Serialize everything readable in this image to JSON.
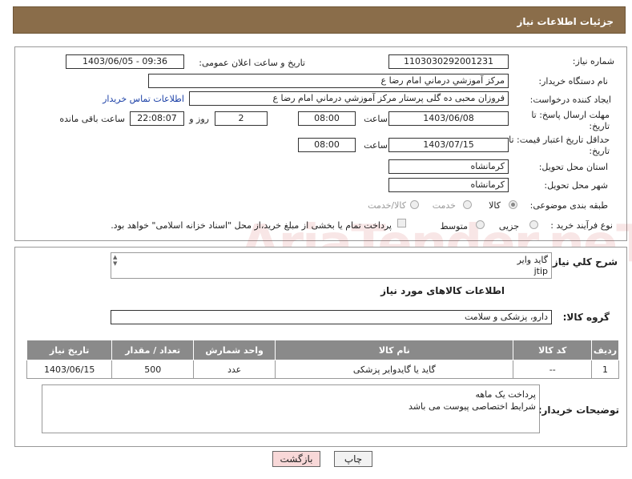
{
  "header": {
    "title": "جزئیات اطلاعات نیاز"
  },
  "form": {
    "need_number_label": "شماره نیاز:",
    "need_number": "1103030292001231",
    "announce_label": "تاریخ و ساعت اعلان عمومی:",
    "announce_value": "1403/06/05 - 09:36",
    "buyer_label": "نام دستگاه خریدار:",
    "buyer_value": "مرکز آموزشي  درماني امام رضا  ع",
    "creator_label": "ایجاد کننده درخواست:",
    "creator_value": "فروزان محبی ده گلی پرستار مرکز آموزشي  درماني امام رضا  ع",
    "contact_link": "اطلاعات تماس خریدار",
    "deadline_label": "مهلت ارسال پاسخ: تا تاریخ:",
    "deadline_date": "1403/06/08",
    "time_label": "ساعت",
    "deadline_time": "08:00",
    "days_value": "2",
    "days_label": "روز و",
    "remaining_value": "22:08:07",
    "remaining_label": "ساعت باقی مانده",
    "validity_label": "حداقل تاریخ اعتبار قیمت: تا تاریخ:",
    "validity_date": "1403/07/15",
    "validity_time": "08:00",
    "province_label": "استان محل تحویل:",
    "province_value": "کرمانشاه",
    "city_label": "شهر محل تحویل:",
    "city_value": "کرمانشاه",
    "category_label": "طبقه بندی موضوعی:",
    "category_options": [
      "کالا",
      "خدمت",
      "کالا/خدمت"
    ],
    "category_selected": "کالا",
    "process_label": "نوع فرآیند خرید :",
    "process_options": [
      "جزیی",
      "متوسط"
    ],
    "payment_note": "پرداخت تمام یا بخشی از مبلغ خرید،از محل \"اسناد خزانه اسلامی\" خواهد بود."
  },
  "details": {
    "summary_label": "شرح کلي نياز:",
    "summary_value": "گاید وایر\njtip",
    "goods_info_title": "اطلاعات کالاهای مورد نیاز",
    "goods_group_label": "گروه کالا:",
    "goods_group_value": "دارو، پزشکی و سلامت",
    "table_headers": [
      "ردیف",
      "کد کالا",
      "نام کالا",
      "واحد شمارش",
      "تعداد / مقدار",
      "تاریخ نیاز"
    ],
    "table_rows": [
      [
        "1",
        "--",
        "گاید یا گایدوایر پزشکی",
        "عدد",
        "500",
        "1403/06/15"
      ]
    ],
    "buyer_notes_label": "توضیحات خریدار:",
    "buyer_notes_value": "پرداخت یک ماهه\nشرایط اختصاصی پیوست می باشد"
  },
  "buttons": {
    "print": "چاپ",
    "back": "بازگشت"
  },
  "watermark": "AriaTender.neT",
  "colors": {
    "header_bg": "#8a6d4a",
    "table_header_bg": "#8a8a8a",
    "link": "#1a3fa6",
    "back_button_bg": "#f8d8d8"
  }
}
